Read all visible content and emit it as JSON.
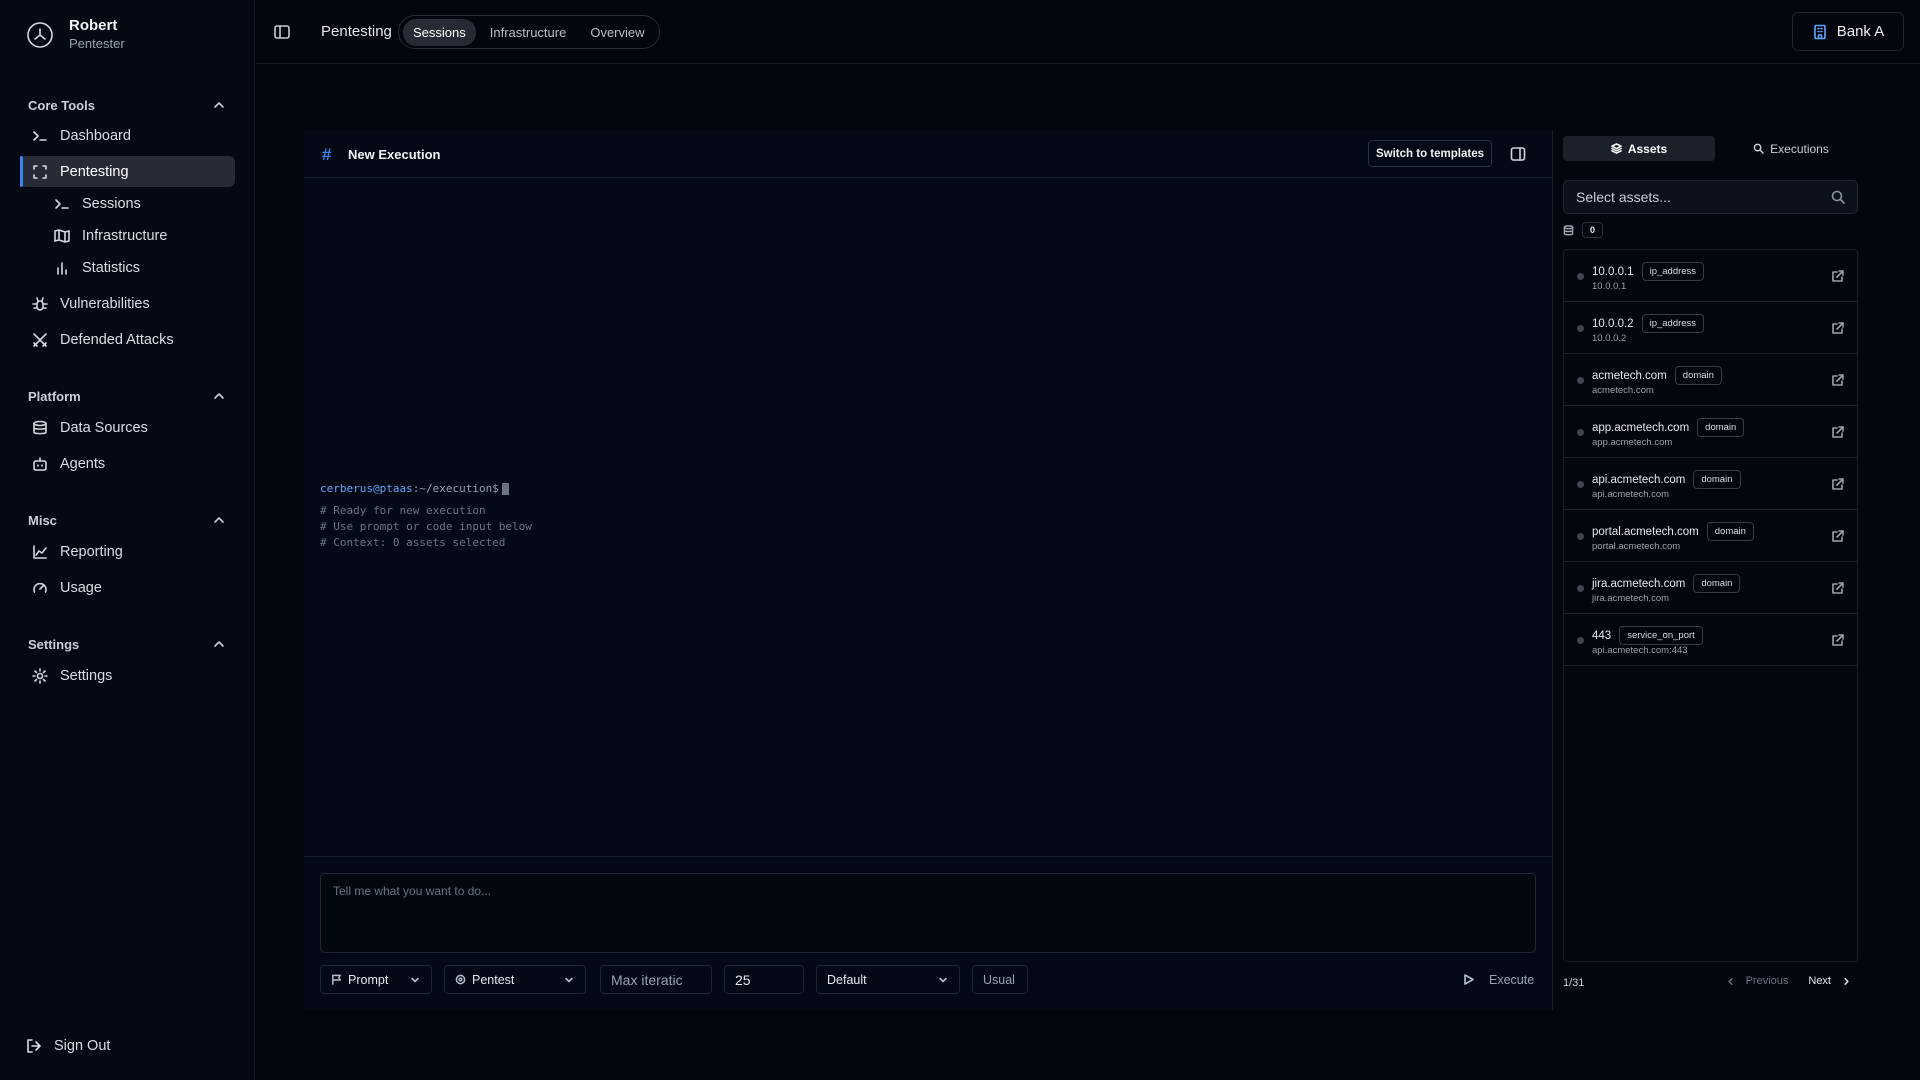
{
  "user": {
    "name": "Robert",
    "role": "Pentester"
  },
  "sidebar": {
    "sections": [
      {
        "title": "Core Tools"
      },
      {
        "title": "Platform"
      },
      {
        "title": "Misc"
      },
      {
        "title": "Settings"
      }
    ],
    "core_tools": {
      "dashboard": "Dashboard",
      "pentesting": "Pentesting",
      "sessions": "Sessions",
      "infrastructure": "Infrastructure",
      "statistics": "Statistics",
      "vulnerabilities": "Vulnerabilities",
      "defended_attacks": "Defended Attacks"
    },
    "platform": {
      "data_sources": "Data Sources",
      "agents": "Agents"
    },
    "misc": {
      "reporting": "Reporting",
      "usage": "Usage"
    },
    "settings": {
      "settings": "Settings"
    },
    "sign_out": "Sign Out"
  },
  "topbar": {
    "breadcrumb": "Pentesting",
    "tabs": [
      "Sessions",
      "Infrastructure",
      "Overview"
    ],
    "active_tab": "Sessions",
    "org": "Bank A"
  },
  "execution": {
    "title": "New Execution",
    "switch_label": "Switch to templates",
    "terminal": {
      "prompt_user": "cerberus@ptaas",
      "prompt_path": ":~/execution$",
      "comments": [
        "# Ready for new execution",
        "# Use prompt or code input below",
        "# Context: 0 assets selected"
      ]
    },
    "input_placeholder": "Tell me what you want to do...",
    "controls": {
      "mode": "Prompt",
      "type": "Pentest",
      "max_iter_placeholder": "Max iteratic",
      "max_iter_value": "25",
      "profile": "Default",
      "usual": "Usual",
      "execute": "Execute"
    }
  },
  "assets_panel": {
    "tabs": [
      "Assets",
      "Executions"
    ],
    "active_tab": "Assets",
    "search_placeholder": "Select assets...",
    "selected_count": "0",
    "items": [
      {
        "name": "10.0.0.1",
        "type": "ip_address",
        "value": "10.0.0.1"
      },
      {
        "name": "10.0.0.2",
        "type": "ip_address",
        "value": "10.0.0.2"
      },
      {
        "name": "acmetech.com",
        "type": "domain",
        "value": "acmetech.com"
      },
      {
        "name": "app.acmetech.com",
        "type": "domain",
        "value": "app.acmetech.com"
      },
      {
        "name": "api.acmetech.com",
        "type": "domain",
        "value": "api.acmetech.com"
      },
      {
        "name": "portal.acmetech.com",
        "type": "domain",
        "value": "portal.acmetech.com"
      },
      {
        "name": "jira.acmetech.com",
        "type": "domain",
        "value": "jira.acmetech.com"
      },
      {
        "name": "443",
        "type": "service_on_port",
        "value": "api.acmetech.com:443"
      }
    ],
    "page_indicator": "1/31",
    "previous": "Previous",
    "next": "Next"
  },
  "colors": {
    "accent": "#3b82f6",
    "background": "#02050d",
    "panel": "#050915"
  }
}
